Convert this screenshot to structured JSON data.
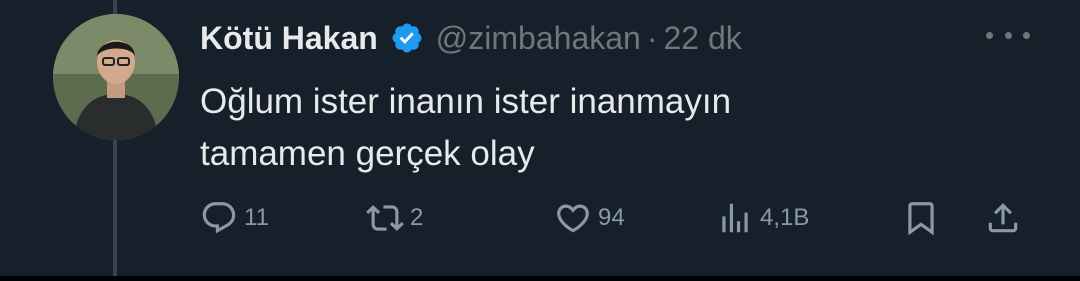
{
  "tweet": {
    "author_name": "Kötü Hakan",
    "handle": "@zimbahakan",
    "separator": "·",
    "time": "22 dk",
    "verified": true,
    "text_lines": [
      "Oğlum ister inanın ister inanmayın",
      "tamamen gerçek olay"
    ]
  },
  "actions": {
    "replies": "11",
    "retweets": "2",
    "likes": "94",
    "views": "4,1B"
  },
  "colors": {
    "background": "#15202b",
    "text": "#e7e9ea",
    "secondary": "#71767b",
    "verified": "#1d9bf0"
  },
  "icons": [
    "reply-icon",
    "retweet-icon",
    "like-icon",
    "views-icon",
    "bookmark-icon",
    "share-icon",
    "more-icon",
    "verified-badge-icon"
  ]
}
